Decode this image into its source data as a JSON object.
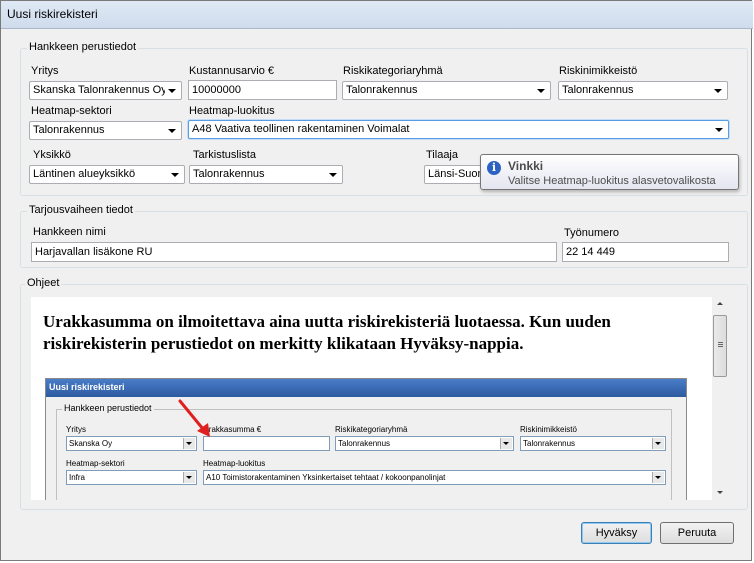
{
  "window": {
    "title": "Uusi riskirekisteri"
  },
  "basics": {
    "group_title": "Hankkeen perustiedot",
    "company": {
      "label": "Yritys",
      "value": "Skanska Talonrakennus Oy"
    },
    "cost": {
      "label": "Kustannusarvio €",
      "value": "10000000"
    },
    "riskcat": {
      "label": "Riskikategoriaryhmä",
      "value": "Talonrakennus"
    },
    "risknames": {
      "label": "Riskinimikkeistö",
      "value": "Talonrakennus"
    },
    "heat_sector": {
      "label": "Heatmap-sektori",
      "value": "Talonrakennus"
    },
    "heat_class": {
      "label": "Heatmap-luokitus",
      "value": "A48 Vaativa teollinen rakentaminen Voimalat"
    },
    "unit": {
      "label": "Yksikkö",
      "value": "Läntinen alueyksikkö"
    },
    "checklist": {
      "label": "Tarkistuslista",
      "value": "Talonrakennus"
    },
    "client": {
      "label": "Tilaaja",
      "value": "Länsi-Suom"
    }
  },
  "tooltip": {
    "title": "Vinkki",
    "text": "Valitse Heatmap-luokitus alasvetovalikosta"
  },
  "tender": {
    "group_title": "Tarjousvaiheen tiedot",
    "project_name": {
      "label": "Hankkeen nimi",
      "value": "Harjavallan lisäkone RU"
    },
    "work_number": {
      "label": "Työnumero",
      "value": "22 14 449"
    }
  },
  "help": {
    "group_title": "Ohjeet",
    "heading": "Urakkasumma on ilmoitettava aina uutta riskirekisteriä luotaessa. Kun uuden riskirekisterin perustiedot on merkitty klikataan Hyväksy-nappia.",
    "mini": {
      "title": "Uusi riskirekisteri",
      "group_title": "Hankkeen perustiedot",
      "company_label": "Yritys",
      "company_value": "Skanska Oy",
      "sum_label": "Urakkasumma €",
      "riskcat_label": "Riskikategoriaryhmä",
      "riskcat_value": "Talonrakennus",
      "risknames_label": "Riskinimikkeistö",
      "risknames_value": "Talonrakennus",
      "sector_label": "Heatmap-sektori",
      "sector_value": "Infra",
      "class_label": "Heatmap-luokitus",
      "class_value": "A10 Toimistorakentaminen Yksinkertaiset tehtaat / kokoonpanolinjat"
    }
  },
  "buttons": {
    "ok": "Hyväksy",
    "cancel": "Peruuta"
  },
  "colors": {
    "arrow": "#e02020",
    "focus_border": "#569de5",
    "titlebar": "#dfe9f5"
  }
}
